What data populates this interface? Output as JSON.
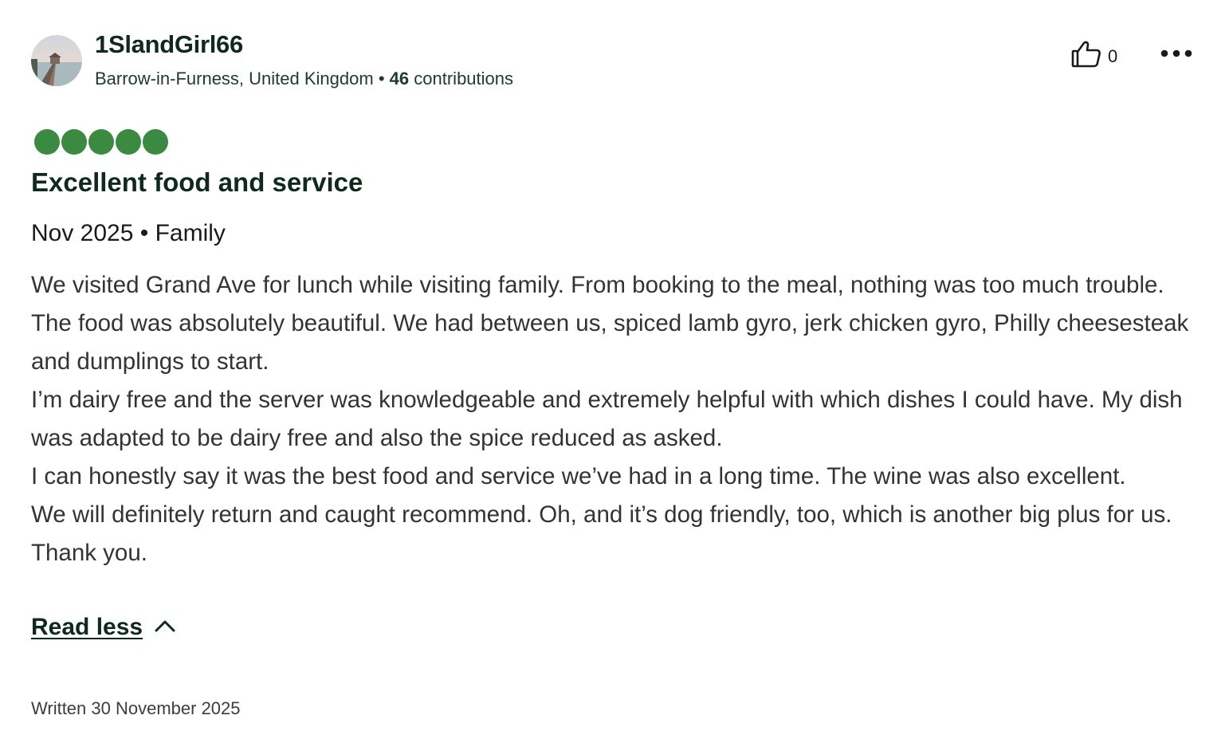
{
  "reviewer": {
    "name": "1SlandGirl66",
    "location": "Barrow-in-Furness, United Kingdom",
    "separator": "•",
    "contributions_count": "46",
    "contributions_label": "contributions"
  },
  "actions": {
    "helpful_count": "0",
    "helpful_icon": "thumbs-up-icon",
    "more_icon": "more-options-icon"
  },
  "review": {
    "rating": 5,
    "rating_max": 5,
    "title": "Excellent food and service",
    "visit_info": "Nov 2025 • Family",
    "paragraphs": [
      "We visited Grand Ave for lunch while visiting family. From booking to the meal, nothing was too much trouble. The food was absolutely beautiful. We had between us, spiced lamb gyro, jerk chicken gyro, Philly cheesesteak and dumplings to start.",
      "I’m dairy free and the server was knowledgeable and extremely helpful with which dishes I could have. My dish was adapted to be dairy free and also the spice reduced as asked.",
      "I can honestly say it was the best food and service we’ve had in a long time. The wine was also excellent.",
      "We will definitely return and caught recommend. Oh, and it’s dog friendly, too, which is another big plus for us. Thank you."
    ],
    "read_less_label": "Read less",
    "written_date": "Written 30 November 2025"
  },
  "colors": {
    "rating_bubble": "#3a8a41",
    "title_text": "#0f2a1d",
    "body_text": "#333333"
  }
}
